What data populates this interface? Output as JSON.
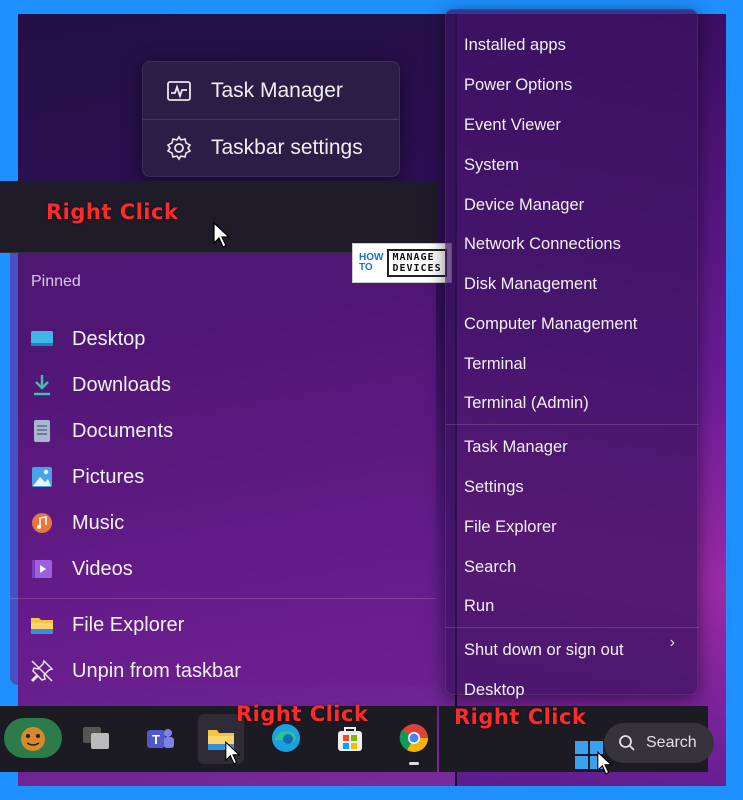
{
  "context_menu": {
    "items": [
      {
        "label": "Task Manager",
        "icon": "task-manager-icon"
      },
      {
        "label": "Taskbar settings",
        "icon": "gear-icon"
      }
    ]
  },
  "annotations": {
    "right_click_1": "Right Click",
    "right_click_2": "Right Click",
    "right_click_3": "Right Click"
  },
  "logo": {
    "left_top": "HOW",
    "left_bottom": "TO",
    "right_top": "MANAGE",
    "right_bottom": "DEVICES"
  },
  "jump_list": {
    "header": "Pinned",
    "pinned": [
      {
        "label": "Desktop",
        "icon": "desktop-folder-icon",
        "color": "#3fb6e8"
      },
      {
        "label": "Downloads",
        "icon": "download-icon",
        "color": "#3fc0b0"
      },
      {
        "label": "Documents",
        "icon": "document-icon",
        "color": "#a9b8d0"
      },
      {
        "label": "Pictures",
        "icon": "pictures-icon",
        "color": "#4aa3e8"
      },
      {
        "label": "Music",
        "icon": "music-icon",
        "color": "#e8743f"
      },
      {
        "label": "Videos",
        "icon": "video-icon",
        "color": "#a05fe0"
      }
    ],
    "actions": [
      {
        "label": "File Explorer",
        "icon": "file-explorer-icon"
      },
      {
        "label": "Unpin from taskbar",
        "icon": "unpin-icon"
      }
    ]
  },
  "winx_menu": {
    "group1": [
      "Installed apps",
      "Power Options",
      "Event Viewer",
      "System",
      "Device Manager",
      "Network Connections",
      "Disk Management",
      "Computer Management",
      "Terminal",
      "Terminal (Admin)"
    ],
    "group2": [
      "Task Manager",
      "Settings",
      "File Explorer",
      "Search",
      "Run"
    ],
    "group3": [
      "Shut down or sign out",
      "Desktop"
    ]
  },
  "taskbar": {
    "search_label": "Search",
    "apps": [
      "widgets-icon",
      "task-view-icon",
      "teams-icon",
      "file-explorer-icon",
      "edge-icon",
      "store-icon",
      "chrome-icon"
    ]
  }
}
